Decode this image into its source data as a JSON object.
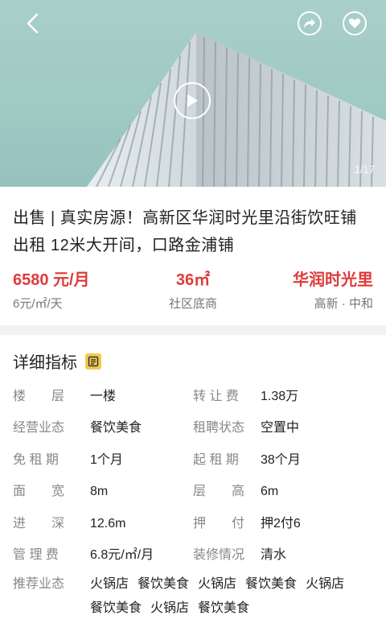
{
  "hero": {
    "counter": "1/17"
  },
  "listing": {
    "title": "出售 | 真实房源！高新区华润时光里沿街饮旺铺出租 12米大开间，口路金浦铺",
    "stats": [
      {
        "main": "6580 元/月",
        "sub": "6元/㎡/天"
      },
      {
        "main": "36㎡",
        "sub": "社区底商"
      },
      {
        "main": "华润时光里",
        "sub": "高新 · 中和"
      }
    ]
  },
  "details": {
    "heading": "详细指标",
    "rows": [
      {
        "l1": "楼　　层",
        "v1": "一楼",
        "l2": "转 让 费",
        "v2": "1.38万"
      },
      {
        "l1": "经营业态",
        "v1": "餐饮美食",
        "l2": "租聘状态",
        "v2": "空置中"
      },
      {
        "l1": "免 租 期",
        "v1": "1个月",
        "l2": "起 租 期",
        "v2": "38个月"
      },
      {
        "l1": "面　　宽",
        "v1": "8m",
        "l2": "层　　高",
        "v2": "6m"
      },
      {
        "l1": "进　　深",
        "v1": "12.6m",
        "l2": "押　　付",
        "v2": "押2付6"
      },
      {
        "l1": "管 理 费",
        "v1": "6.8元/㎡/月",
        "l2": "装修情况",
        "v2": "清水"
      }
    ],
    "recommend_label": "推荐业态",
    "recommend_tags": [
      "火锅店",
      "餐饮美食",
      "火锅店",
      "餐饮美食",
      "火锅店",
      "餐饮美食",
      "火锅店",
      "餐饮美食"
    ]
  },
  "colors": {
    "accent": "#e03a3a",
    "label": "#888888",
    "divider": "#f2f2f2"
  }
}
